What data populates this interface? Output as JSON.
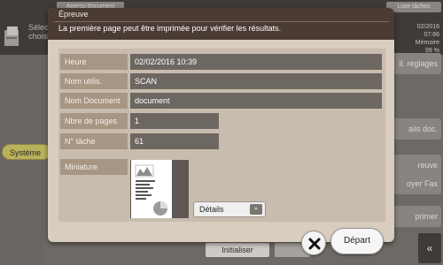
{
  "background": {
    "top_buttons": [
      "Aperçu document",
      "Liste tâches"
    ],
    "select_text": [
      "Sélec",
      "choisi"
    ],
    "status_lines": [
      "02/2016",
      "07:66",
      "Mémoire",
      "99 %"
    ],
    "right_buttons": [
      "il. réglages",
      "ails doc.",
      "reuve",
      "oyer Fax",
      "primer"
    ],
    "system_label": "Système",
    "init_label": "Initialiser",
    "back_icon": "double-chevron-left-icon"
  },
  "dialog": {
    "title": "Épreuve",
    "message": "La première page peut être imprimée pour vérifier les résultats.",
    "rows": [
      {
        "label": "Heure",
        "value": "02/02/2016 10:39"
      },
      {
        "label": "Nom utilis.",
        "value": "SCAN"
      },
      {
        "label": "Nom Document",
        "value": "document"
      },
      {
        "label": "Nbre de pages",
        "value": "1"
      },
      {
        "label": "N° tâche",
        "value": "61"
      }
    ],
    "thumbnail_label": "Miniature",
    "details_label": "Détails",
    "details_icon": "double-chevron-right-icon",
    "close_icon": "close-icon",
    "depart_label": "Départ"
  }
}
